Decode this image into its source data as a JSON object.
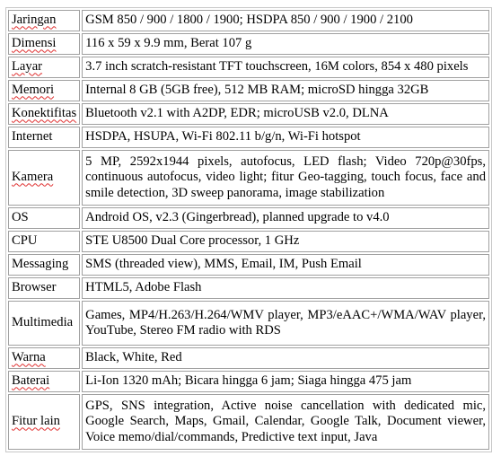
{
  "specs": [
    {
      "label": "Jaringan",
      "value": "GSM 850 / 900 / 1800 / 1900; HSDPA 850 / 900 / 1900 / 2100",
      "spell": true
    },
    {
      "label": "Dimensi",
      "value": "116 x 59 x 9.9 mm, Berat 107 g",
      "spell": true
    },
    {
      "label": "Layar",
      "value": "3.7 inch scratch-resistant TFT touchscreen, 16M colors, 854 x 480 pixels",
      "spell": true
    },
    {
      "label": "Memori",
      "value": "Internal 8 GB (5GB free), 512 MB RAM; microSD hingga 32GB",
      "spell": true
    },
    {
      "label": "Konektifitas",
      "value": "Bluetooth v2.1 with A2DP, EDR; microUSB v2.0, DLNA",
      "spell": true
    },
    {
      "label": "Internet",
      "value": "HSDPA, HSUPA, Wi-Fi 802.11 b/g/n, Wi-Fi hotspot",
      "spell": false
    },
    {
      "label": "Kamera",
      "value": "5 MP, 2592x1944 pixels, autofocus, LED flash; Video 720p@30fps, continuous autofocus, video light; fitur Geo-tagging, touch focus, face and smile detection, 3D sweep panorama, image stabilization",
      "spell": true
    },
    {
      "label": "OS",
      "value": "Android OS, v2.3 (Gingerbread), planned upgrade to v4.0",
      "spell": false
    },
    {
      "label": "CPU",
      "value": "STE U8500 Dual Core processor, 1 GHz",
      "spell": false
    },
    {
      "label": "Messaging",
      "value": "SMS (threaded view), MMS, Email, IM, Push Email",
      "spell": false
    },
    {
      "label": "Browser",
      "value": "HTML5, Adobe Flash",
      "spell": false
    },
    {
      "label": "Multimedia",
      "value": "Games, MP4/H.263/H.264/WMV player, MP3/eAAC+/WMA/WAV player, YouTube, Stereo FM radio with RDS",
      "spell": false
    },
    {
      "label": "Warna",
      "value": "Black, White, Red",
      "spell": true
    },
    {
      "label": "Baterai",
      "value": "Li-Ion 1320 mAh; Bicara hingga 6 jam; Siaga hingga 475 jam",
      "spell": true
    },
    {
      "label": "Fitur lain",
      "value": "GPS, SNS integration, Active noise cancellation with dedicated mic, Google Search, Maps, Gmail, Calendar, Google Talk, Document viewer, Voice memo/dial/commands, Predictive text input, Java",
      "spell": true
    }
  ]
}
